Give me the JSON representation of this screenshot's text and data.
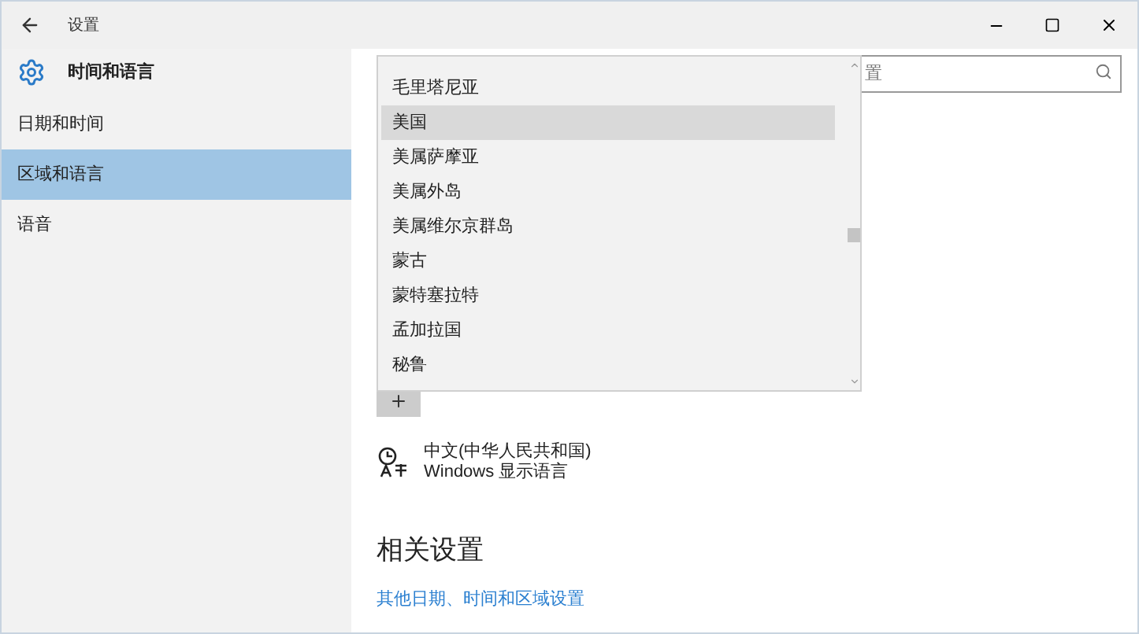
{
  "window": {
    "title": "设置"
  },
  "header": {
    "title": "时间和语言"
  },
  "search": {
    "placeholder": "置"
  },
  "sidebar": {
    "items": [
      {
        "label": "日期和时间",
        "selected": false
      },
      {
        "label": "区域和语言",
        "selected": true
      },
      {
        "label": "语音",
        "selected": false
      }
    ]
  },
  "dropdown": {
    "items": [
      {
        "label": "毛里塔尼亚",
        "selected": false
      },
      {
        "label": "美国",
        "selected": true
      },
      {
        "label": "美属萨摩亚",
        "selected": false
      },
      {
        "label": "美属外岛",
        "selected": false
      },
      {
        "label": "美属维尔京群岛",
        "selected": false
      },
      {
        "label": "蒙古",
        "selected": false
      },
      {
        "label": "蒙特塞拉特",
        "selected": false
      },
      {
        "label": "孟加拉国",
        "selected": false
      },
      {
        "label": "秘鲁",
        "selected": false
      }
    ]
  },
  "languages": [
    {
      "name": "中文(中华人民共和国)",
      "note": "Windows 显示语言"
    }
  ],
  "related": {
    "heading": "相关设置",
    "links": [
      "其他日期、时间和区域设置"
    ]
  }
}
